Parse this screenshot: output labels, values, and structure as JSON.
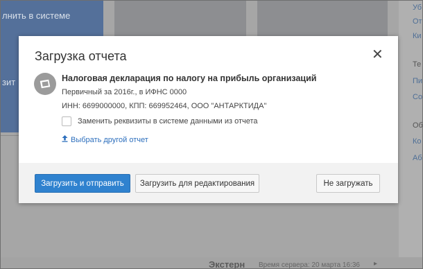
{
  "background": {
    "tile_text_1": "лнить в системе",
    "tile_text_2": "зит",
    "right_links": [
      "Уб",
      "От",
      "Ки",
      "Те",
      "Пи",
      "Со",
      "Об",
      "Ко",
      "Аб"
    ],
    "bottom_brand": "Экстерн",
    "bottom_time": "Время сервера: 20 марта 16:36",
    "bottom_arrow": "▸"
  },
  "modal": {
    "title": "Загрузка отчета",
    "close_glyph": "✕",
    "doc_title": "Налоговая декларация по налогу на прибыль организаций",
    "doc_period": "Первичный за 2016г., в ИФНС 0000",
    "doc_org": "ИНН: 6699000000, КПП: 669952464, ООО \"АНТАРКТИДА\"",
    "replace_checkbox_label": "Заменить реквизиты в системе данными из отчета",
    "select_other_link": "Выбрать другой отчет",
    "buttons": {
      "upload_send": "Загрузить и отправить",
      "upload_edit": "Загрузить для редактирования",
      "dont_upload": "Не загружать"
    }
  },
  "colors": {
    "primary": "#2f82cf",
    "link": "#2d6fbd",
    "overlay": "#a6a6a6"
  },
  "icons": {
    "document": "document-icon",
    "upload": "upload-arrow-icon",
    "close": "close-icon"
  }
}
